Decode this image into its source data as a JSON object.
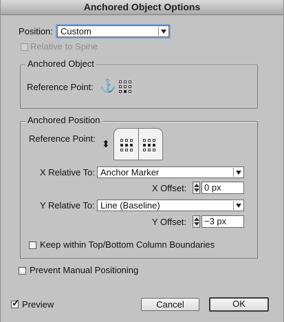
{
  "window": {
    "title": "Anchored Object Options"
  },
  "position": {
    "label": "Position:",
    "value": "Custom"
  },
  "relative_to_spine": {
    "label": "Relative to Spine",
    "checked": false,
    "enabled": false
  },
  "anchored_object": {
    "title": "Anchored Object",
    "reference_point_label": "Reference Point:"
  },
  "anchored_position": {
    "title": "Anchored Position",
    "reference_point_label": "Reference Point:",
    "x_relative_label": "X Relative To:",
    "x_relative_value": "Anchor Marker",
    "x_offset_label": "X Offset:",
    "x_offset_value": "0 px",
    "y_relative_label": "Y Relative To:",
    "y_relative_value": "Line (Baseline)",
    "y_offset_label": "Y Offset:",
    "y_offset_value": "−3 px",
    "keep_within_label": "Keep within Top/Bottom Column Boundaries"
  },
  "prevent_manual": {
    "label": "Prevent Manual Positioning",
    "checked": false
  },
  "preview": {
    "label": "Preview",
    "checked": true,
    "check_glyph": "✓"
  },
  "buttons": {
    "cancel": "Cancel",
    "ok": "OK"
  },
  "icons": {
    "anchor": "⚓",
    "spread_toggle": "⬍"
  }
}
